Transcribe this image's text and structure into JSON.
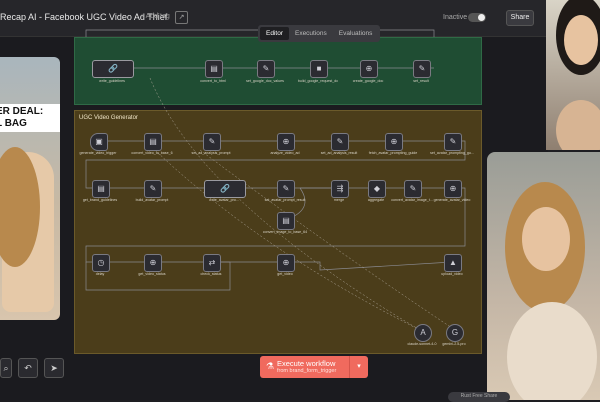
{
  "header": {
    "title": "Recap AI - Facebook UGC Video Ad Thief",
    "add_tag": "+ Add tag",
    "tabs": [
      {
        "label": "Editor",
        "active": true
      },
      {
        "label": "Executions",
        "active": false
      },
      {
        "label": "Evaluations",
        "active": false
      }
    ],
    "status": "Inactive",
    "share_label": "Share"
  },
  "canvas": {
    "sticky_notes": [
      {
        "title": "",
        "color": "#1f4d33"
      },
      {
        "title": "UGC Video Generator",
        "color": "#4b3d1a"
      }
    ],
    "nodes": [
      {
        "icon": "🔗",
        "label": "write_guidelines"
      },
      {
        "icon": "▤",
        "label": "convert_to_html"
      },
      {
        "icon": "✎",
        "label": "set_google_doc_values"
      },
      {
        "icon": "■",
        "label": "build_google_request_dc"
      },
      {
        "icon": "⊕",
        "label": "create_google_doc"
      },
      {
        "icon": "✎",
        "label": "set_result"
      },
      {
        "icon": "▣",
        "label": "generate_video_trigger"
      },
      {
        "icon": "▤",
        "label": "convert_video_to_base_6"
      },
      {
        "icon": "✎",
        "label": "set_ad_analysis_prompt"
      },
      {
        "icon": "⊕",
        "label": "analyze_video_ad"
      },
      {
        "icon": "✎",
        "label": "set_ad_analysis_result"
      },
      {
        "icon": "⊕",
        "label": "fetch_avatar_prompting_guide"
      },
      {
        "icon": "✎",
        "label": "set_avatar_prompting_gu..."
      },
      {
        "icon": "▤",
        "label": "get_brand_guidelines"
      },
      {
        "icon": "✎",
        "label": "build_avatar_prompt"
      },
      {
        "icon": "🔗",
        "label": "write_avatar_pro..."
      },
      {
        "icon": "✎",
        "label": "set_avatar_prompt_result"
      },
      {
        "icon": "⇶",
        "label": "merge"
      },
      {
        "icon": "◆",
        "label": "aggregate"
      },
      {
        "icon": "✎",
        "label": "convert_avatar_image_t..."
      },
      {
        "icon": "⊕",
        "label": "generate_avatar_video"
      },
      {
        "icon": "▤",
        "label": "convert_image_to_base_64"
      },
      {
        "icon": "◷",
        "label": "delay"
      },
      {
        "icon": "⊕",
        "label": "get_video_status"
      },
      {
        "icon": "⇄",
        "label": "check_status"
      },
      {
        "icon": "⊕",
        "label": "get_video"
      },
      {
        "icon": "▲",
        "label": "upload_video"
      },
      {
        "icon": "A",
        "label": "claude-sonnet-4-0"
      },
      {
        "icon": "G",
        "label": "gemini-2.5-pro"
      }
    ]
  },
  "execute": {
    "label": "Execute workflow",
    "sub": "from brand_form_trigger"
  },
  "bottom_tools": [
    "⌕",
    "↶",
    "➤"
  ],
  "corner_pill": "Rust Free Share"
}
